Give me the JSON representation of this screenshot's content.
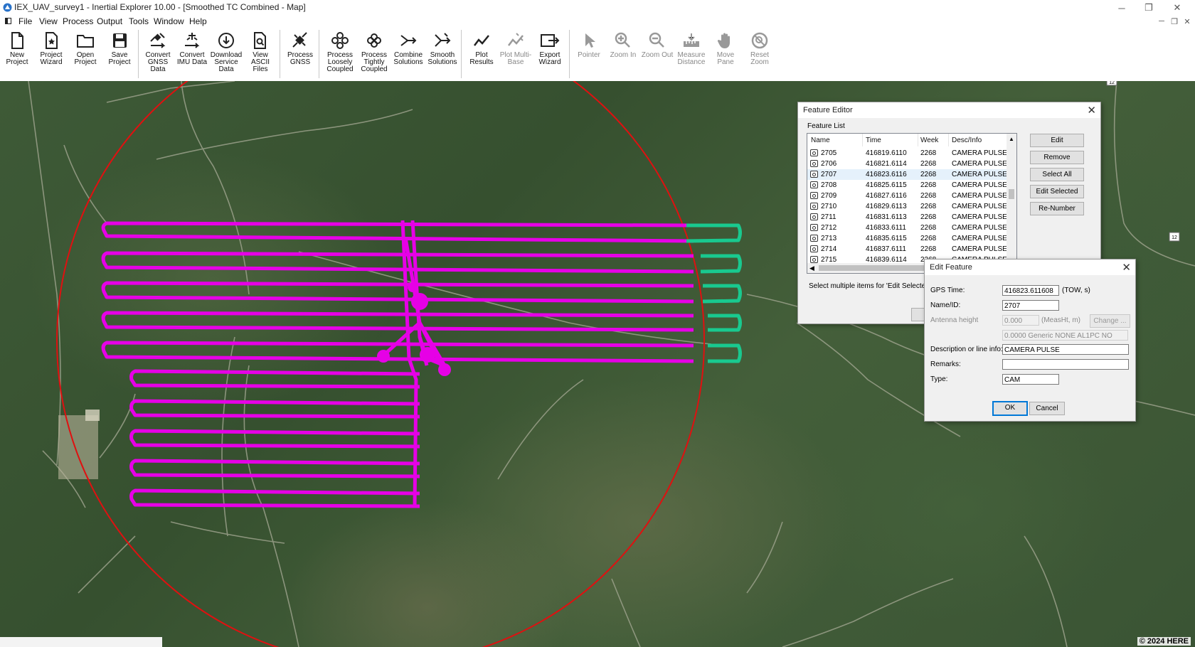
{
  "window": {
    "title": "IEX_UAV_survey1 - Inertial Explorer 10.00 - [Smoothed TC Combined - Map]",
    "controls": {
      "minimize": "─",
      "restore": "❐",
      "close": "✕"
    },
    "mdi_controls": {
      "minimize": "─",
      "restore": "❐",
      "close": "✕"
    }
  },
  "menu": [
    "File",
    "View",
    "Process",
    "Output",
    "Tools",
    "Window",
    "Help"
  ],
  "toolbar": {
    "new_project": "New Project",
    "project_wizard": "Project Wizard",
    "open_project": "Open Project",
    "save_project": "Save Project",
    "convert_gnss": "Convert GNSS Data",
    "convert_imu": "Convert IMU Data",
    "download_service": "Download Service Data",
    "view_ascii": "View ASCII Files",
    "process_gnss": "Process GNSS",
    "process_loosely": "Process Loosely Coupled",
    "process_tightly": "Process Tightly Coupled",
    "combine": "Combine Solutions",
    "smooth": "Smooth Solutions",
    "plot_results": "Plot Results",
    "plot_multi": "Plot Multi-Base",
    "export_wizard": "Export Wizard",
    "pointer": "Pointer",
    "zoom_in": "Zoom In",
    "zoom_out": "Zoom Out",
    "measure": "Measure Distance",
    "move_pane": "Move Pane",
    "reset_zoom": "Reset Zoom"
  },
  "map": {
    "copyright": "© 2024 HERE",
    "route_badges": [
      "12",
      "12"
    ],
    "colors": {
      "trajectory": "#e600e6",
      "trajectory_end": "#19c98f",
      "range_circle": "#e01010"
    }
  },
  "feature_editor": {
    "title": "Feature Editor",
    "group_label": "Feature List",
    "columns": [
      "Name",
      "Time",
      "Week",
      "Desc/Info"
    ],
    "rows": [
      {
        "name": "2705",
        "time": "416819.6110",
        "week": "2268",
        "desc": "CAMERA PULSE"
      },
      {
        "name": "2706",
        "time": "416821.6114",
        "week": "2268",
        "desc": "CAMERA PULSE"
      },
      {
        "name": "2707",
        "time": "416823.6116",
        "week": "2268",
        "desc": "CAMERA PULSE"
      },
      {
        "name": "2708",
        "time": "416825.6115",
        "week": "2268",
        "desc": "CAMERA PULSE"
      },
      {
        "name": "2709",
        "time": "416827.6116",
        "week": "2268",
        "desc": "CAMERA PULSE"
      },
      {
        "name": "2710",
        "time": "416829.6113",
        "week": "2268",
        "desc": "CAMERA PULSE"
      },
      {
        "name": "2711",
        "time": "416831.6113",
        "week": "2268",
        "desc": "CAMERA PULSE"
      },
      {
        "name": "2712",
        "time": "416833.6111",
        "week": "2268",
        "desc": "CAMERA PULSE"
      },
      {
        "name": "2713",
        "time": "416835.6115",
        "week": "2268",
        "desc": "CAMERA PULSE"
      },
      {
        "name": "2714",
        "time": "416837.6111",
        "week": "2268",
        "desc": "CAMERA PULSE"
      },
      {
        "name": "2715",
        "time": "416839.6114",
        "week": "2268",
        "desc": "CAMERA PULSE"
      }
    ],
    "selected_row": "2707",
    "buttons": {
      "edit": "Edit",
      "remove": "Remove",
      "select_all": "Select All",
      "edit_selected": "Edit Selected",
      "renumber": "Re-Number"
    },
    "hint": "Select multiple items for 'Edit Selected' o"
  },
  "edit_feature": {
    "title": "Edit Feature",
    "gps_time_label": "GPS Time:",
    "gps_time": "416823.611608",
    "gps_time_unit": "(TOW, s)",
    "name_label": "Name/ID:",
    "name": "2707",
    "antenna_label": "Antenna height",
    "antenna_value": "0.000",
    "antenna_unit": "(MeasHt, m)",
    "change_button": "Change ...",
    "antenna_desc": "0.0000 Generic NONE AL1PC NO",
    "desc_label": "Description or line info:",
    "desc": "CAMERA PULSE",
    "remarks_label": "Remarks:",
    "remarks": "",
    "type_label": "Type:",
    "type": "CAM",
    "ok": "OK",
    "cancel": "Cancel"
  }
}
